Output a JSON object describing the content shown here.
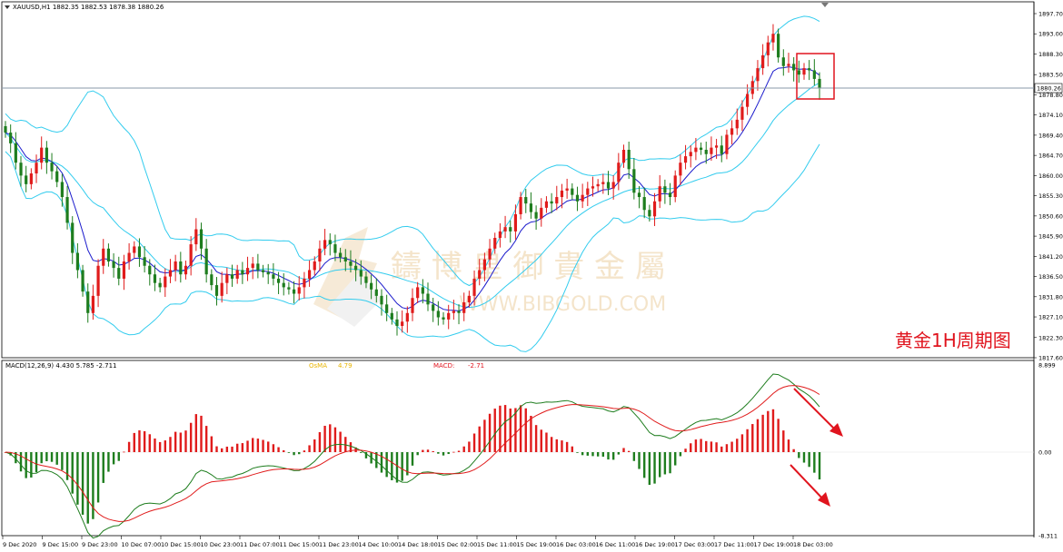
{
  "header": {
    "symbol_info": "XAUUSD,H1  1882.35 1882.53 1878.38 1880.26",
    "macd_info": "MACD(12,26,9) 4.430 5.785 -2.711",
    "osma_label": "OsMA",
    "osma_value": "4.79",
    "macd_label": "MACD:",
    "macd_value": "-2.71"
  },
  "annotation": {
    "title": "黄金1H周期图"
  },
  "watermark": {
    "cn": "鑄 博 皇 御 貴 金 屬",
    "url": "WWW.BIBGOLD.COM"
  },
  "price_axis": {
    "ticks": [
      "1897.70",
      "1893.00",
      "1888.30",
      "1883.50",
      "1878.80",
      "1874.10",
      "1869.40",
      "1864.70",
      "1860.00",
      "1855.30",
      "1850.60",
      "1845.90",
      "1841.20",
      "1836.50",
      "1831.80",
      "1827.10",
      "1822.30",
      "1817.60"
    ],
    "current": "1880.26"
  },
  "macd_axis": {
    "ticks": [
      "8.899",
      "0.00",
      "-8.311"
    ]
  },
  "time_axis": {
    "ticks": [
      "9 Dec 2020",
      "9 Dec 15:00",
      "9 Dec 23:00",
      "10 Dec 07:00",
      "10 Dec 15:00",
      "10 Dec 23:00",
      "11 Dec 07:00",
      "11 Dec 15:00",
      "11 Dec 23:00",
      "14 Dec 10:00",
      "14 Dec 18:00",
      "15 Dec 02:00",
      "15 Dec 11:00",
      "15 Dec 19:00",
      "16 Dec 03:00",
      "16 Dec 11:00",
      "16 Dec 19:00",
      "17 Dec 03:00",
      "17 Dec 11:00",
      "17 Dec 19:00",
      "18 Dec 03:00"
    ]
  },
  "colors": {
    "bull": "#e01b1b",
    "bear": "#1e7d1e",
    "band": "#33ccee",
    "ma": "#1a1acc",
    "signal": "#e01b1b",
    "macd_line": "#1e7d1e",
    "alert": "#e0141e"
  },
  "chart_data": {
    "type": "candlestick",
    "price_range": [
      1817.6,
      1899.0
    ],
    "closes": [
      1870.0,
      1867.5,
      1863.0,
      1860.0,
      1858.0,
      1860.5,
      1863.0,
      1866.5,
      1863.0,
      1861.0,
      1858.5,
      1855.0,
      1849.0,
      1842.0,
      1838.0,
      1833.0,
      1828.0,
      1832.0,
      1839.0,
      1843.0,
      1840.0,
      1838.5,
      1836.0,
      1840.0,
      1842.0,
      1843.5,
      1841.0,
      1839.0,
      1837.0,
      1835.0,
      1834.0,
      1836.5,
      1838.0,
      1840.0,
      1837.0,
      1839.0,
      1844.0,
      1847.5,
      1843.0,
      1837.0,
      1834.5,
      1832.0,
      1835.0,
      1837.0,
      1836.0,
      1838.0,
      1837.0,
      1838.5,
      1839.5,
      1838.0,
      1837.5,
      1837.0,
      1836.0,
      1835.0,
      1834.0,
      1833.5,
      1832.5,
      1834.0,
      1836.0,
      1838.0,
      1840.0,
      1843.0,
      1845.0,
      1844.0,
      1842.0,
      1841.0,
      1840.0,
      1839.0,
      1838.0,
      1836.5,
      1835.0,
      1833.5,
      1832.0,
      1830.0,
      1828.0,
      1826.5,
      1825.0,
      1826.0,
      1828.0,
      1831.5,
      1834.0,
      1832.5,
      1830.0,
      1828.5,
      1827.0,
      1826.5,
      1828.0,
      1828.5,
      1828.0,
      1830.5,
      1832.0,
      1836.0,
      1838.0,
      1840.5,
      1843.0,
      1845.5,
      1847.0,
      1848.0,
      1847.0,
      1851.0,
      1855.0,
      1853.5,
      1851.5,
      1850.0,
      1852.5,
      1854.0,
      1853.5,
      1855.0,
      1856.5,
      1857.0,
      1855.5,
      1854.0,
      1855.5,
      1857.0,
      1857.5,
      1858.0,
      1858.5,
      1857.0,
      1858.5,
      1863.0,
      1866.0,
      1861.5,
      1856.0,
      1855.0,
      1852.0,
      1850.5,
      1854.0,
      1857.5,
      1856.0,
      1855.0,
      1860.0,
      1863.0,
      1864.5,
      1865.5,
      1866.5,
      1866.0,
      1865.0,
      1866.5,
      1867.0,
      1865.0,
      1869.5,
      1871.0,
      1873.0,
      1876.0,
      1879.0,
      1882.0,
      1885.0,
      1888.0,
      1891.0,
      1893.0,
      1887.5,
      1885.5,
      1886.0,
      1884.5,
      1883.5,
      1885.0,
      1884.5,
      1882.5,
      1880.26
    ]
  }
}
